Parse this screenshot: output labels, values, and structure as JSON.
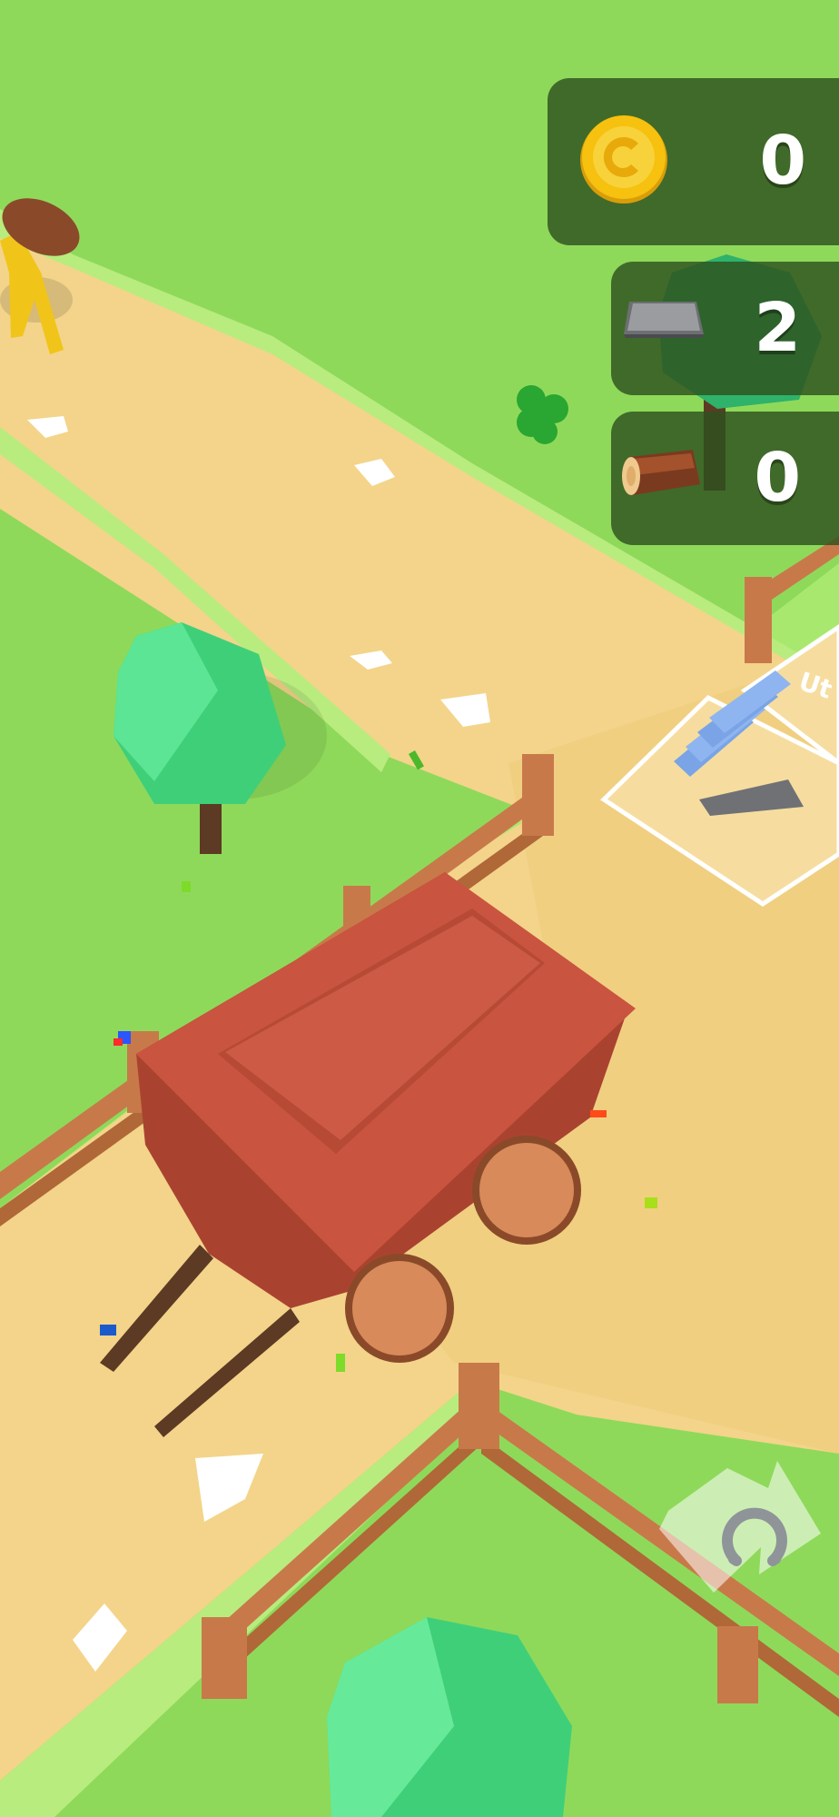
{
  "hud": {
    "coins": {
      "icon": "coin-icon",
      "value": "0"
    },
    "iron_bars": {
      "icon": "iron-bar-icon",
      "value": "2"
    },
    "logs": {
      "icon": "log-icon",
      "value": "0"
    }
  },
  "scene": {
    "zone_label": "Ut",
    "rotate_button_icon": "horseshoe-icon"
  },
  "colors": {
    "grass": "#8fd95a",
    "path": "#f3d48a",
    "wagon": "#c9543f",
    "fence": "#c8794a",
    "hud_panel": "#2e521e",
    "coin": "#f6c10f"
  }
}
